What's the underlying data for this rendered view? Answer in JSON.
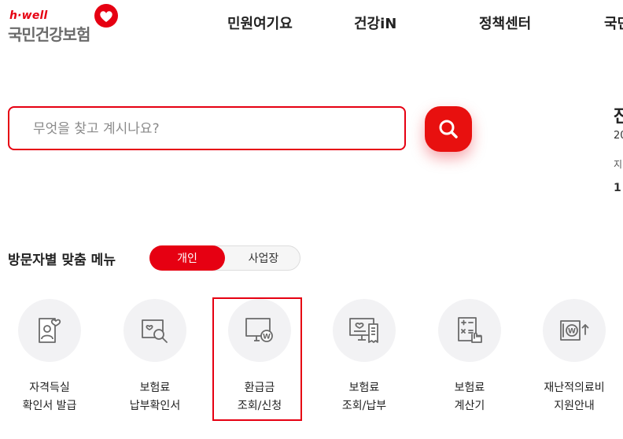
{
  "logo": {
    "tag": "h·well",
    "name": "국민건강보험"
  },
  "nav": [
    "민원여기요",
    "건강iN",
    "정책센터",
    "국민"
  ],
  "search": {
    "placeholder": "무엇을 찾고 계시나요?",
    "value": ""
  },
  "side_panel": {
    "title": "잔",
    "line1": "20",
    "line2": "지",
    "line3": "1"
  },
  "menu": {
    "title": "방문자별 맞춤 메뉴",
    "toggle": {
      "active": "개인",
      "inactive": "사업장"
    },
    "items": [
      {
        "label": "자격득실\n확인서 발급",
        "icon": "certificate-person-icon"
      },
      {
        "label": "보험료\n납부확인서",
        "icon": "document-search-icon"
      },
      {
        "label": "환급금\n조회/신청",
        "icon": "monitor-refund-icon"
      },
      {
        "label": "보험료\n조회/납부",
        "icon": "monitor-receipt-icon"
      },
      {
        "label": "보험료\n계산기",
        "icon": "calculator-hand-icon"
      },
      {
        "label": "재난적의료비\n지원안내",
        "icon": "bill-support-icon"
      }
    ]
  },
  "colors": {
    "accent": "#e60012",
    "icon": "#6a6a6a",
    "circle_bg": "#f2f2f4"
  }
}
